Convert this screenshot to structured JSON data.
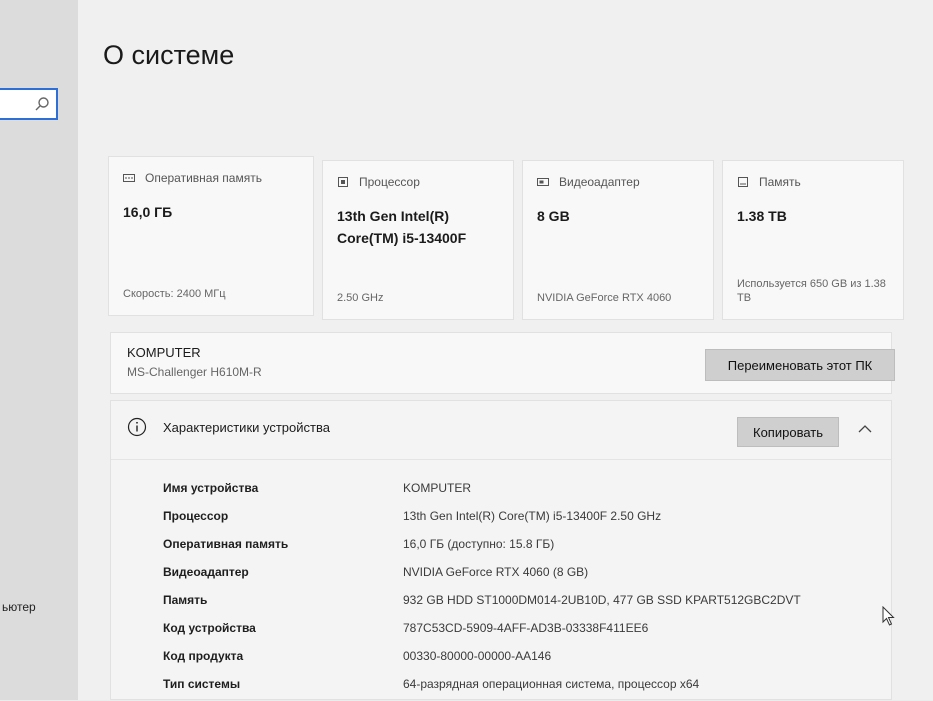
{
  "page": {
    "title": "О системе"
  },
  "sidebar": {
    "partial_label": "ьютер"
  },
  "cards": [
    {
      "title": "Оперативная память",
      "value": "16,0 ГБ",
      "sub": "Скорость: 2400 МГц",
      "icon": "ram-icon"
    },
    {
      "title": "Процессор",
      "value": "13th Gen Intel(R) Core(TM) i5-13400F",
      "sub": "2.50 GHz",
      "icon": "cpu-icon"
    },
    {
      "title": "Видеоадаптер",
      "value": "8 GB",
      "sub": "NVIDIA GeForce RTX 4060",
      "icon": "gpu-icon"
    },
    {
      "title": "Память",
      "value": "1.38 TB",
      "sub": "Используется 650 GB из 1.38 TB",
      "icon": "storage-icon"
    }
  ],
  "device": {
    "name": "KOMPUTER",
    "model": "MS-Challenger H610M-R",
    "rename_label": "Переименовать этот ПК"
  },
  "specs": {
    "title": "Характеристики устройства",
    "copy_label": "Копировать",
    "rows": [
      {
        "label": "Имя устройства",
        "value": "KOMPUTER"
      },
      {
        "label": "Процессор",
        "value": "13th Gen Intel(R) Core(TM) i5-13400F   2.50 GHz"
      },
      {
        "label": "Оперативная память",
        "value": "16,0 ГБ (доступно: 15.8 ГБ)"
      },
      {
        "label": "Видеоадаптер",
        "value": "NVIDIA GeForce RTX 4060 (8 GB)"
      },
      {
        "label": "Память",
        "value": "932 GB HDD ST1000DM014-2UB10D, 477 GB SSD KPART512GBC2DVT"
      },
      {
        "label": "Код устройства",
        "value": "787C53CD-5909-4AFF-AD3B-03338F411EE6"
      },
      {
        "label": "Код продукта",
        "value": "00330-80000-00000-AA146"
      },
      {
        "label": "Тип системы",
        "value": "64-разрядная операционная система, процессор x64"
      }
    ]
  }
}
